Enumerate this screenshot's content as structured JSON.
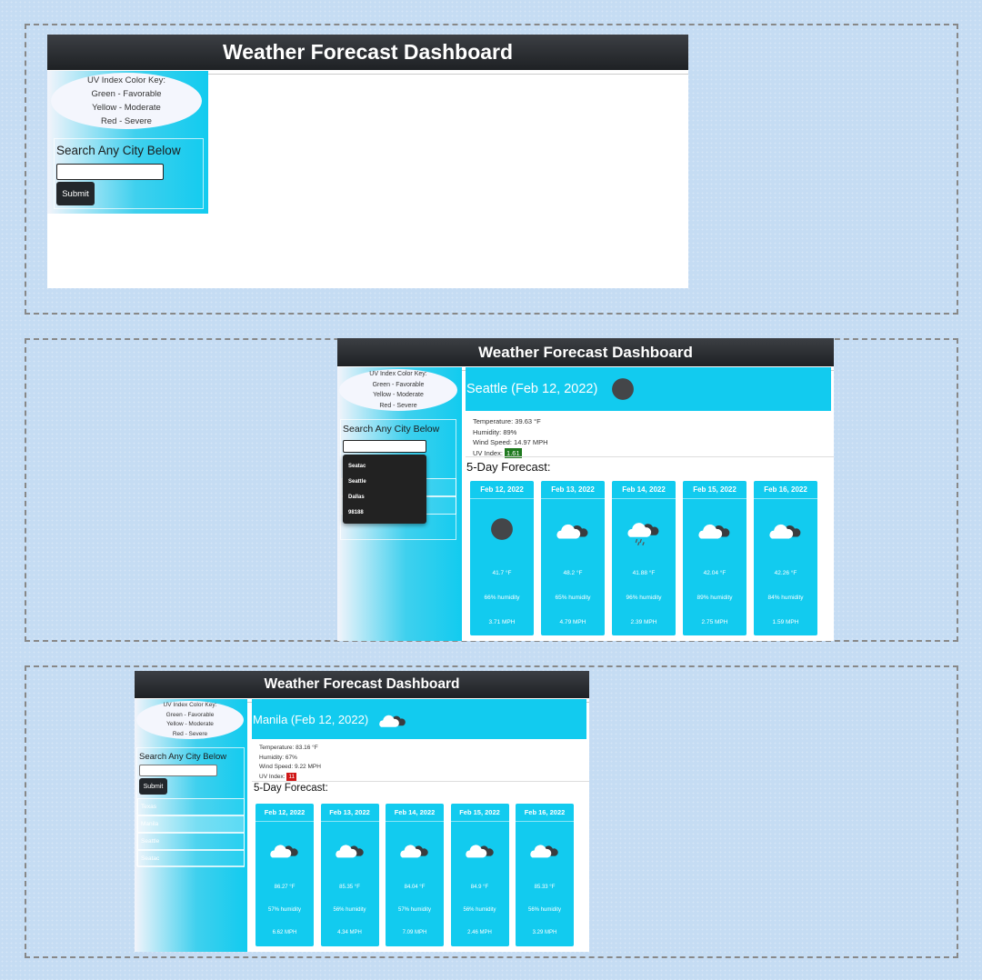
{
  "app_title": "Weather Forecast Dashboard",
  "uv_key": {
    "title": "UV Index Color Key:",
    "green": "Green - Favorable",
    "yellow": "Yellow - Moderate",
    "red": "Red - Severe"
  },
  "search": {
    "label": "Search Any City Below",
    "submit_label": "Submit",
    "value": ""
  },
  "panel2": {
    "dropdown": [
      "Seatac",
      "Seattle",
      "Dallas",
      "98188"
    ],
    "current": {
      "heading": "Seattle (Feb 12, 2022)",
      "icon": "moon-icon",
      "temperature": "Temperature: 39.63 °F",
      "humidity": "Humidity: 89%",
      "wind": "Wind Speed: 14.97 MPH",
      "uv_label": "UV Index:",
      "uv_value": "1.61",
      "uv_color": "#1f7a1f"
    },
    "forecast_title": "5-Day Forecast:",
    "forecast": [
      {
        "date": "Feb 12, 2022",
        "icon": "moon-icon",
        "temp": "41.7 °F",
        "humidity": "66% humidity",
        "wind": "3.71 MPH"
      },
      {
        "date": "Feb 13, 2022",
        "icon": "cloud-icon",
        "temp": "48.2 °F",
        "humidity": "65% humidity",
        "wind": "4.79 MPH"
      },
      {
        "date": "Feb 14, 2022",
        "icon": "rain-cloud-icon",
        "temp": "41.88 °F",
        "humidity": "96% humidity",
        "wind": "2.39 MPH"
      },
      {
        "date": "Feb 15, 2022",
        "icon": "cloud-icon",
        "temp": "42.04 °F",
        "humidity": "89% humidity",
        "wind": "2.75 MPH"
      },
      {
        "date": "Feb 16, 2022",
        "icon": "cloud-icon",
        "temp": "42.26 °F",
        "humidity": "84% humidity",
        "wind": "1.59 MPH"
      }
    ]
  },
  "panel3": {
    "history": [
      "Texas",
      "Manila",
      "Seattle",
      "Seatac"
    ],
    "current": {
      "heading": "Manila (Feb 12, 2022)",
      "icon": "cloud-icon",
      "temperature": "Temperature: 83.16 °F",
      "humidity": "Humidity: 67%",
      "wind": "Wind Speed: 9.22 MPH",
      "uv_label": "UV Index:",
      "uv_value": "11",
      "uv_color": "#d01818"
    },
    "forecast_title": "5-Day Forecast:",
    "forecast": [
      {
        "date": "Feb 12, 2022",
        "icon": "cloud-icon",
        "temp": "86.27 °F",
        "humidity": "57% humidity",
        "wind": "6.62 MPH"
      },
      {
        "date": "Feb 13, 2022",
        "icon": "cloud-icon",
        "temp": "85.35 °F",
        "humidity": "56% humidity",
        "wind": "4.34 MPH"
      },
      {
        "date": "Feb 14, 2022",
        "icon": "cloud-icon",
        "temp": "84.04 °F",
        "humidity": "57% humidity",
        "wind": "7.09 MPH"
      },
      {
        "date": "Feb 15, 2022",
        "icon": "cloud-icon",
        "temp": "84.9 °F",
        "humidity": "56% humidity",
        "wind": "2.46 MPH"
      },
      {
        "date": "Feb 16, 2022",
        "icon": "cloud-icon",
        "temp": "85.33 °F",
        "humidity": "56% humidity",
        "wind": "3.29 MPH"
      }
    ]
  }
}
